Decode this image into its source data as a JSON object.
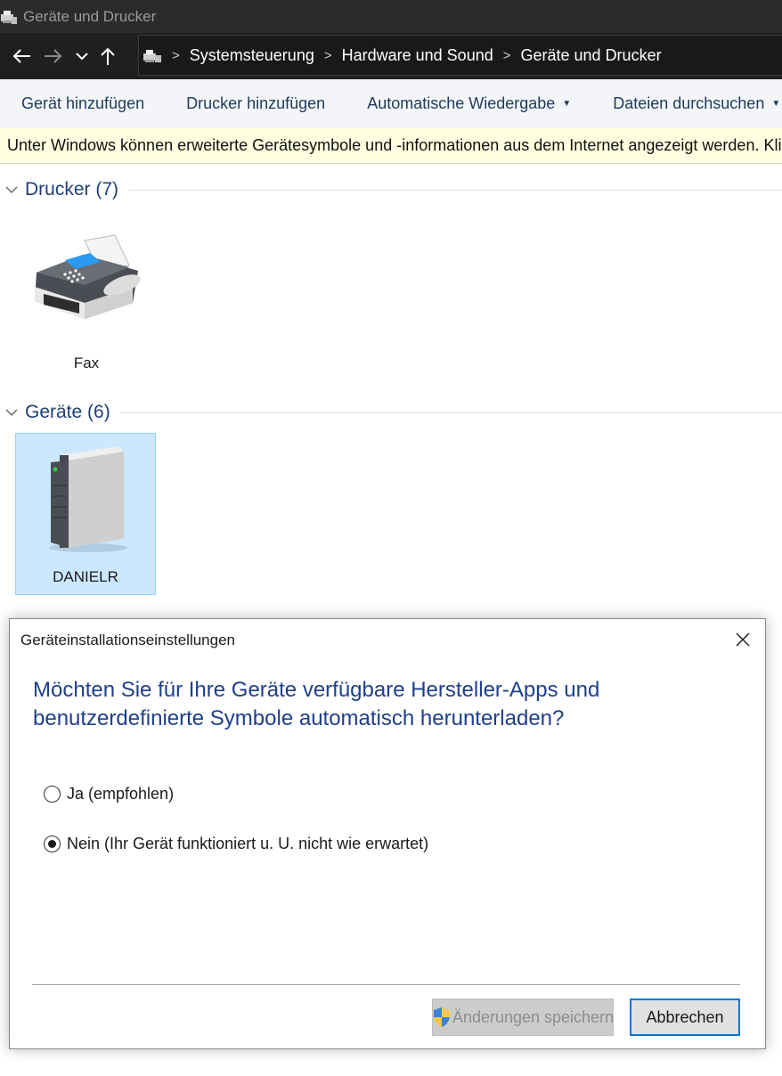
{
  "window": {
    "title": "Geräte und Drucker"
  },
  "address_bar": {
    "breadcrumbs": [
      "Systemsteuerung",
      "Hardware und Sound",
      "Geräte und Drucker"
    ]
  },
  "toolbar": {
    "items": [
      "Gerät hinzufügen",
      "Drucker hinzufügen",
      "Automatische Wiedergabe",
      "Dateien durchsuchen"
    ]
  },
  "infobar": {
    "text": "Unter Windows können erweiterte Gerätesymbole und -informationen aus dem Internet angezeigt werden. Klic"
  },
  "groups": {
    "printers": {
      "title": "Drucker (7)",
      "items": [
        {
          "label": "Fax",
          "icon": "fax-icon"
        }
      ]
    },
    "devices": {
      "title": "Geräte (6)",
      "items": [
        {
          "label": "DANIELR",
          "icon": "computer-tower-icon",
          "selected": true
        }
      ]
    }
  },
  "dialog": {
    "title": "Geräteinstallationseinstellungen",
    "heading_line1": "Möchten Sie für Ihre Geräte verfügbare Hersteller-Apps und",
    "heading_line2": "benutzerdefinierte Symbole automatisch herunterladen?",
    "options": [
      {
        "label": "Ja (empfohlen)",
        "selected": false
      },
      {
        "label": "Nein (Ihr Gerät funktioniert u. U. nicht wie erwartet)",
        "selected": true
      }
    ],
    "save_label": "Änderungen speichern",
    "save_icon": "uac-shield-icon",
    "cancel_label": "Abbrechen"
  },
  "colors": {
    "heading_blue": "#1f3f8a",
    "selection_bg": "#cce8ff",
    "infobar_bg": "#fefee0",
    "focus_border": "#0078d7"
  }
}
